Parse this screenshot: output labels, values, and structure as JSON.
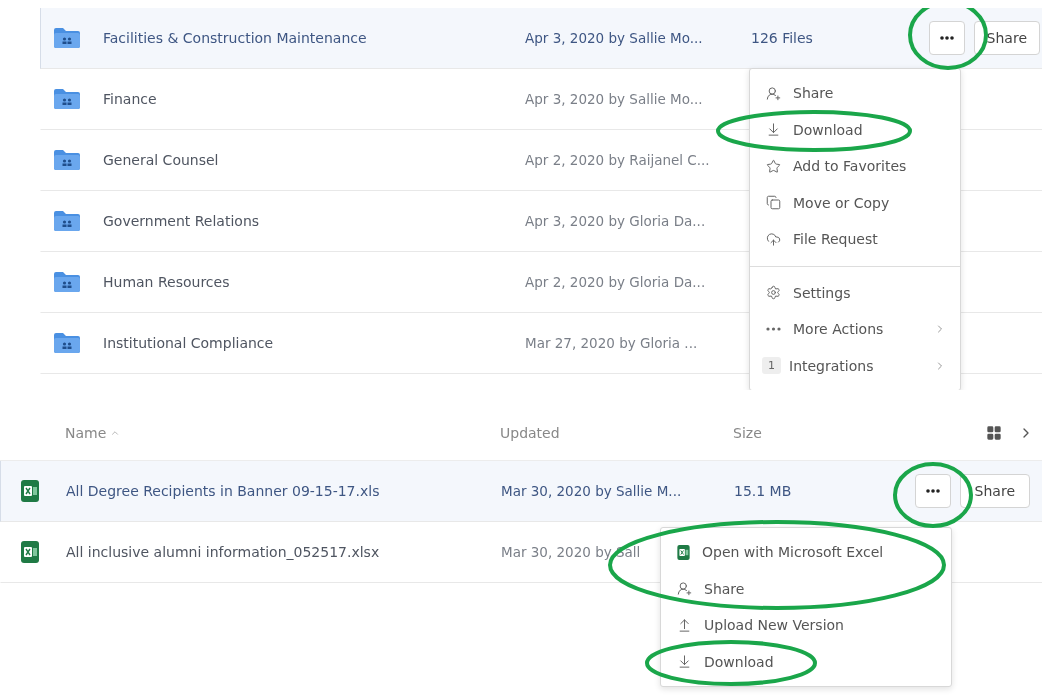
{
  "top_list": {
    "share_button": "Share",
    "rows": [
      {
        "name": "Facilities & Construction Maintenance",
        "updated": "Apr 3, 2020 by Sallie Mo...",
        "size": "126 Files",
        "selected": true
      },
      {
        "name": "Finance",
        "updated": "Apr 3, 2020 by Sallie Mo...",
        "selected": false
      },
      {
        "name": "General Counsel",
        "updated": "Apr 2, 2020 by Raijanel C...",
        "selected": false
      },
      {
        "name": "Government Relations",
        "updated": "Apr 3, 2020 by Gloria Da...",
        "selected": false
      },
      {
        "name": "Human Resources",
        "updated": "Apr 2, 2020 by Gloria Da...",
        "selected": false
      },
      {
        "name": "Institutional Compliance",
        "updated": "Mar 27, 2020 by Gloria ...",
        "selected": false
      }
    ],
    "menu": {
      "groups": [
        [
          {
            "kind": "share",
            "label": "Share"
          },
          {
            "kind": "download",
            "label": "Download"
          },
          {
            "kind": "favorite",
            "label": "Add to Favorites"
          },
          {
            "kind": "move",
            "label": "Move or Copy"
          },
          {
            "kind": "request",
            "label": "File Request"
          }
        ],
        [
          {
            "kind": "settings",
            "label": "Settings"
          },
          {
            "kind": "more",
            "label": "More Actions",
            "submenu": true
          },
          {
            "kind": "integrations",
            "label": "Integrations",
            "badge": "1",
            "submenu": true
          }
        ]
      ]
    }
  },
  "bottom_list": {
    "columns": [
      "Name",
      "Updated",
      "Size"
    ],
    "share_button": "Share",
    "rows": [
      {
        "name": "All Degree Recipients in Banner 09-15-17.xls",
        "updated": "Mar 30, 2020 by Sallie M...",
        "size": "15.1 MB",
        "selected": true
      },
      {
        "name": "All inclusive alumni information_052517.xlsx",
        "updated": "Mar 30, 2020 by Sall",
        "selected": false
      }
    ],
    "menu": {
      "items": [
        {
          "kind": "excel",
          "label": "Open with Microsoft Excel"
        },
        {
          "kind": "share",
          "label": "Share"
        },
        {
          "kind": "upload",
          "label": "Upload New Version"
        },
        {
          "kind": "download",
          "label": "Download"
        }
      ]
    }
  }
}
